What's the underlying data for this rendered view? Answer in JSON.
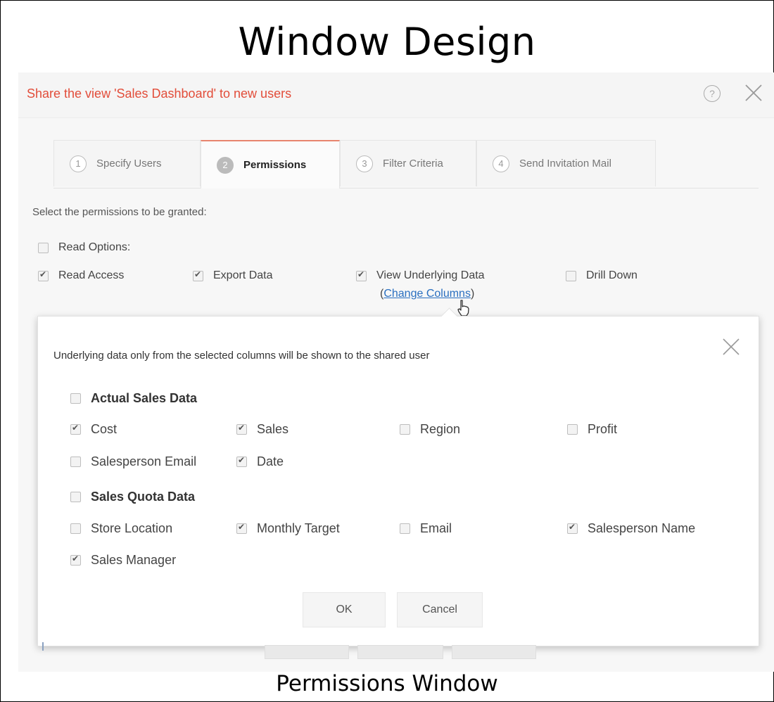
{
  "slide": {
    "title": "Window Design",
    "caption": "Permissions Window"
  },
  "dialog": {
    "title": "Share the view 'Sales Dashboard' to new users",
    "help_glyph": "?",
    "accent_color": "#e24d3a"
  },
  "tabs": [
    {
      "num": "1",
      "label": "Specify Users",
      "active": false
    },
    {
      "num": "2",
      "label": "Permissions",
      "active": true
    },
    {
      "num": "3",
      "label": "Filter Criteria",
      "active": false
    },
    {
      "num": "4",
      "label": "Send Invitation Mail",
      "active": false
    }
  ],
  "permissions": {
    "prompt": "Select the permissions to be granted:",
    "read_options": {
      "label": "Read Options:",
      "checked": false
    },
    "items": [
      {
        "label": "Read Access",
        "checked": true
      },
      {
        "label": "Export Data",
        "checked": true
      },
      {
        "label": "View Underlying Data",
        "checked": true
      },
      {
        "label": "Drill Down",
        "checked": false
      }
    ],
    "change_columns": {
      "open": "(",
      "link": "Change Columns",
      "close": ")"
    }
  },
  "popup": {
    "description": "Underlying data only from the selected columns will be shown to the shared user",
    "groups": [
      {
        "name": "Actual Sales Data",
        "checked": false,
        "columns": [
          {
            "label": "Cost",
            "checked": true
          },
          {
            "label": "Sales",
            "checked": true
          },
          {
            "label": "Region",
            "checked": false
          },
          {
            "label": "Profit",
            "checked": false
          },
          {
            "label": "Salesperson Email",
            "checked": false
          },
          {
            "label": "Date",
            "checked": true
          }
        ]
      },
      {
        "name": "Sales Quota Data",
        "checked": false,
        "columns": [
          {
            "label": "Store Location",
            "checked": false
          },
          {
            "label": "Monthly Target",
            "checked": true
          },
          {
            "label": "Email",
            "checked": false
          },
          {
            "label": "Salesperson Name",
            "checked": true
          },
          {
            "label": "Sales Manager",
            "checked": true
          }
        ]
      }
    ],
    "ok_label": "OK",
    "cancel_label": "Cancel"
  }
}
